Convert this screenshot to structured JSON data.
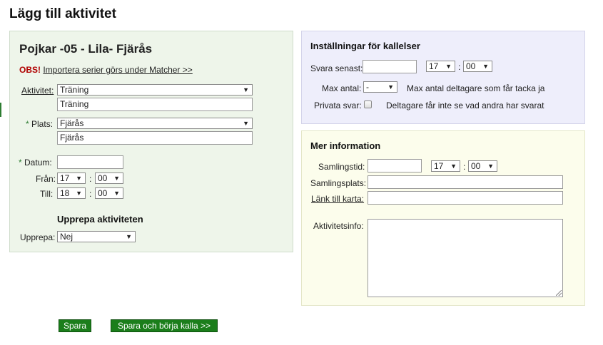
{
  "page": {
    "title": "Lägg till aktivitet"
  },
  "activity": {
    "team_name": "Pojkar -05 - Lila- Fjärås",
    "obs_label": "OBS!",
    "obs_link": "Importera serier görs under Matcher >>",
    "aktivitet_label": "Aktivitet:",
    "aktivitet_value": "Träning",
    "aktivitet_text": "Träning",
    "required_mark": "*",
    "plats_label": "Plats:",
    "plats_value": "Fjärås",
    "plats_text": "Fjärås",
    "datum_label": "Datum:",
    "datum_value": "",
    "fran_label": "Från:",
    "fran_hour": "17",
    "fran_min": "00",
    "till_label": "Till:",
    "till_hour": "18",
    "till_min": "00",
    "repeat_title": "Upprepa aktiviteten",
    "upprepa_label": "Upprepa:",
    "upprepa_value": "Nej"
  },
  "kallelser": {
    "title": "Inställningar för kallelser",
    "svara_label": "Svara senast:",
    "svara_value": "",
    "svara_hour": "17",
    "svara_min": "00",
    "max_label": "Max antal:",
    "max_value": "-",
    "max_hint": "Max antal deltagare som får tacka ja",
    "privata_label": "Privata svar:",
    "privata_hint": "Deltagare får inte se vad andra har svarat"
  },
  "mer": {
    "title": "Mer information",
    "samlingstid_label": "Samlingstid:",
    "samlingstid_value": "",
    "samlingstid_hour": "17",
    "samlingstid_min": "00",
    "samlingsplats_label": "Samlingsplats:",
    "lank_label": "Länk till karta:",
    "info_label": "Aktivitetsinfo:"
  },
  "common": {
    "colon": ":",
    "arrow": "▼"
  },
  "buttons": {
    "save": "Spara",
    "save_call": "Spara och börja kalla >>"
  }
}
